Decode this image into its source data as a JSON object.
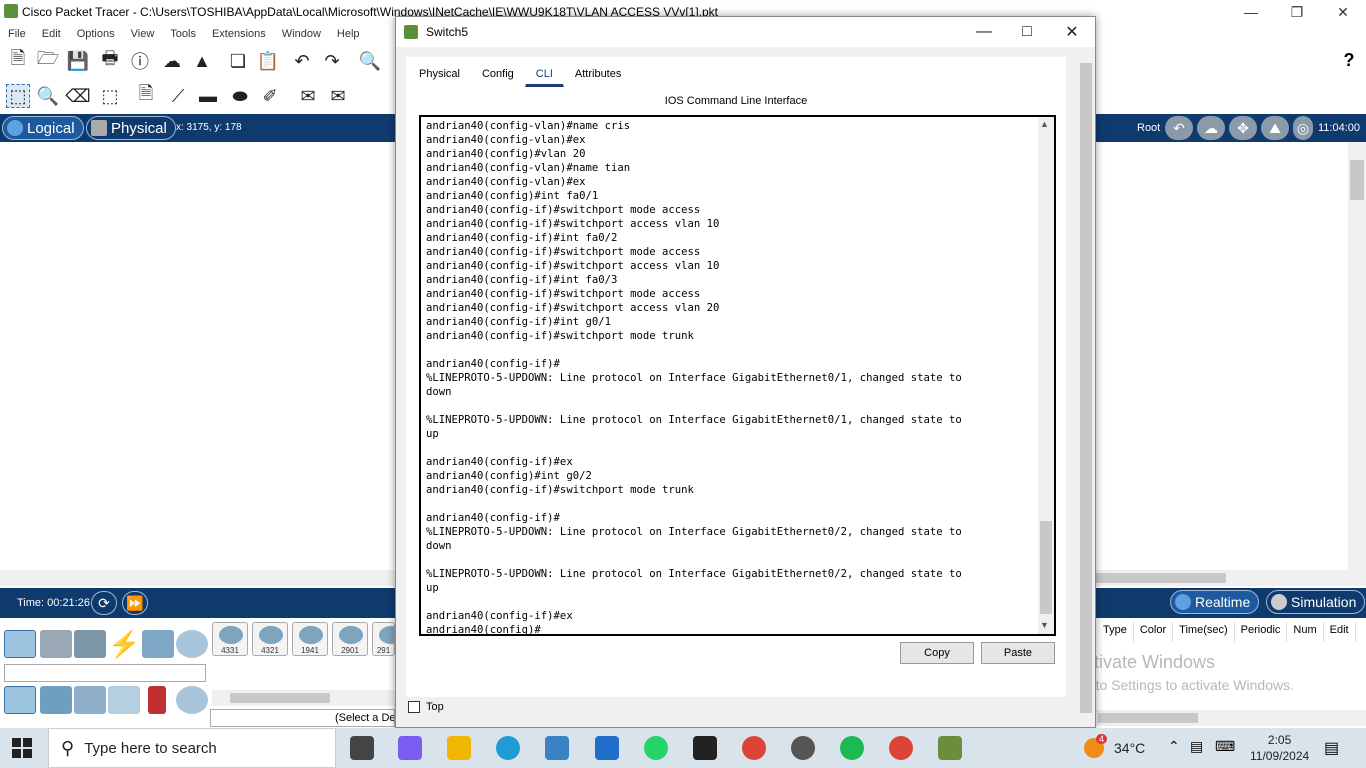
{
  "window": {
    "title": "Cisco Packet Tracer - C:\\Users\\TOSHIBA\\AppData\\Local\\Microsoft\\Windows\\INetCache\\IE\\WWU9K18T\\VLAN ACCESS VVv[1].pkt"
  },
  "menu": [
    "File",
    "Edit",
    "Options",
    "View",
    "Tools",
    "Extensions",
    "Window",
    "Help"
  ],
  "workspace": {
    "logical_label": "Logical",
    "physical_label": "Physical",
    "coords": "x: 3175, y: 178",
    "root_label": "Root",
    "clock": "11:04:00"
  },
  "timebar": {
    "time": "Time: 00:21:26",
    "realtime_label": "Realtime",
    "simulation_label": "Simulation"
  },
  "devices": {
    "routers": [
      "4331",
      "4321",
      "1941",
      "2901",
      "291"
    ],
    "select_hint": "(Select a De"
  },
  "pdu_columns": [
    "Type",
    "Color",
    "Time(sec)",
    "Periodic",
    "Num",
    "Edit"
  ],
  "watermark": {
    "line1": "Activate Windows",
    "line2": "Go to Settings to activate Windows."
  },
  "taskbar": {
    "search_placeholder": "Type here to search",
    "temperature": "34°C",
    "time": "2:05",
    "date": "11/09/2024",
    "weather_badge": "4"
  },
  "dialog": {
    "title": "Switch5",
    "tabs": [
      "Physical",
      "Config",
      "CLI",
      "Attributes"
    ],
    "active_tab": "CLI",
    "cli_heading": "IOS Command Line Interface",
    "cli_lines": [
      "andrian40(config-vlan)#name cris",
      "andrian40(config-vlan)#ex",
      "andrian40(config)#vlan 20",
      "andrian40(config-vlan)#name tian",
      "andrian40(config-vlan)#ex",
      "andrian40(config)#int fa0/1",
      "andrian40(config-if)#switchport mode access",
      "andrian40(config-if)#switchport access vlan 10",
      "andrian40(config-if)#int fa0/2",
      "andrian40(config-if)#switchport mode access",
      "andrian40(config-if)#switchport access vlan 10",
      "andrian40(config-if)#int fa0/3",
      "andrian40(config-if)#switchport mode access",
      "andrian40(config-if)#switchport access vlan 20",
      "andrian40(config-if)#int g0/1",
      "andrian40(config-if)#switchport mode trunk",
      "",
      "andrian40(config-if)#",
      "%LINEPROTO-5-UPDOWN: Line protocol on Interface GigabitEthernet0/1, changed state to",
      "down",
      "",
      "%LINEPROTO-5-UPDOWN: Line protocol on Interface GigabitEthernet0/1, changed state to",
      "up",
      "",
      "andrian40(config-if)#ex",
      "andrian40(config)#int g0/2",
      "andrian40(config-if)#switchport mode trunk",
      "",
      "andrian40(config-if)#",
      "%LINEPROTO-5-UPDOWN: Line protocol on Interface GigabitEthernet0/2, changed state to",
      "down",
      "",
      "%LINEPROTO-5-UPDOWN: Line protocol on Interface GigabitEthernet0/2, changed state to",
      "up",
      "",
      "andrian40(config-if)#ex",
      "andrian40(config)#"
    ],
    "copy_label": "Copy",
    "paste_label": "Paste",
    "top_label": "Top"
  }
}
